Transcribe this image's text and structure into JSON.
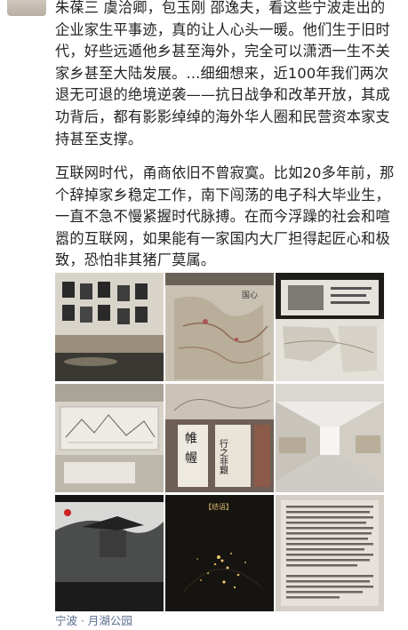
{
  "post": {
    "paragraph_1": "朱葆三 虞洽卿，包玉刚 邵逸夫，看这些宁波走出的企业家生平事迹，真的让人心头一暖。他们生于旧时代，好些远遁他乡甚至海外，完全可以潇洒一生不关家乡甚至大陆发展。...细细想来，近100年我们两次退无可退的绝境逆袭——抗日战争和改革开放，其成功背后，都有影影绰绰的海外华人圈和民营资本家支持甚至支撑。",
    "paragraph_2": "互联网时代，甬商依旧不曾寂寞。比如20多年前，那个辞掉家乡稳定工作，南下闯荡的电子科大毕业生，一直不急不慢紧握时代脉搏。在而今浮躁的社会和喧嚣的互联网，如果能有一家国内大厂担得起匠心和极致，恐怕非其猪厂莫属。",
    "location": "宁波 · 月湖公园"
  },
  "photos": [
    {
      "name": "photo-portrait-wall"
    },
    {
      "name": "photo-old-map"
    },
    {
      "name": "photo-exhibit-panel"
    },
    {
      "name": "photo-drawings-display"
    },
    {
      "name": "photo-calligraphy"
    },
    {
      "name": "photo-gallery-corridor"
    },
    {
      "name": "photo-pavilion-screen"
    },
    {
      "name": "photo-night-map"
    },
    {
      "name": "photo-text-panel"
    }
  ],
  "photo_texts": {
    "map_title": "国心",
    "calligraphy_1": "帷",
    "calligraphy_2": "幄",
    "calligraphy_3": "行之非艱",
    "night_header": "【结语】"
  }
}
